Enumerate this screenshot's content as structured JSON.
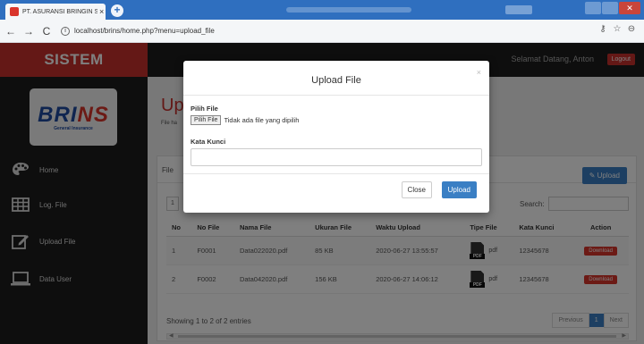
{
  "browser": {
    "tab_title": "PT. ASURANSI BRINGIN SEJAHTE",
    "tab_close": "×",
    "new_tab": "+",
    "url": "localhost/brins/home.php?menu=upload_file"
  },
  "sidebar": {
    "brand": "SISTEM",
    "logo_text_a": "BRI",
    "logo_text_b": "NS",
    "logo_sub": "General Insurance",
    "items": [
      {
        "label": "Home",
        "icon": "palette-icon"
      },
      {
        "label": "Log. File",
        "icon": "table-icon"
      },
      {
        "label": "Upload File",
        "icon": "edit-icon"
      },
      {
        "label": "Data User",
        "icon": "laptop-icon"
      }
    ]
  },
  "header": {
    "welcome": "Selamat Datang, Anton",
    "logout": "Logout"
  },
  "main": {
    "title": "Up",
    "subtitle": "File ha",
    "card_title": "File",
    "upload_button": "Upload",
    "length": "1",
    "search_label": "Search:",
    "columns": [
      "No",
      "No File",
      "Nama File",
      "Ukuran File",
      "Waktu Upload",
      "Tipe File",
      "Kata Kunci",
      "Action"
    ],
    "rows": [
      {
        "no": "1",
        "no_file": "F0001",
        "nama": "Data022020.pdf",
        "ukuran": "85 KB",
        "waktu": "2020-06-27 13:55:57",
        "tipe": "pdf",
        "kunci": "12345678",
        "action": "Download"
      },
      {
        "no": "2",
        "no_file": "F0002",
        "nama": "Data042020.pdf",
        "ukuran": "156 KB",
        "waktu": "2020-06-27 14:06:12",
        "tipe": "pdf",
        "kunci": "12345678",
        "action": "Download"
      }
    ],
    "showing": "Showing 1 to 2 of 2 entries",
    "pager": {
      "prev": "Previous",
      "page": "1",
      "next": "Next"
    }
  },
  "modal": {
    "title": "Upload File",
    "close_x": "×",
    "file_label": "Pilih File",
    "file_button": "Pilih File",
    "file_status": "Tidak ada file yang dipilih",
    "keyword_label": "Kata Kunci",
    "keyword_value": "",
    "btn_close": "Close",
    "btn_upload": "Upload"
  },
  "colors": {
    "brand_red": "#c9302c",
    "sidebar_bg": "#1c1c1c",
    "primary_blue": "#3a7fc4",
    "download_red": "#d9342b"
  }
}
